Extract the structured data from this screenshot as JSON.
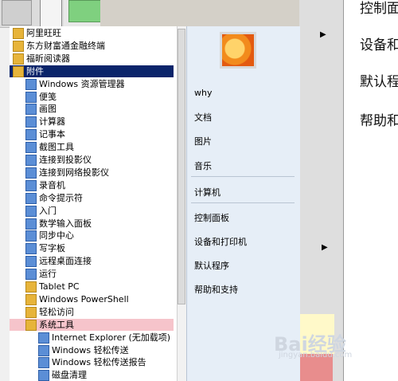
{
  "programs": {
    "items": [
      {
        "label": "阿里旺旺",
        "icon": "folder-icon",
        "type": "folder",
        "selected": false,
        "indent": 0
      },
      {
        "label": "东方财富通金融终端",
        "icon": "folder-icon",
        "type": "folder",
        "selected": false,
        "indent": 0
      },
      {
        "label": "福昕阅读器",
        "icon": "folder-icon",
        "type": "folder",
        "selected": false,
        "indent": 0
      },
      {
        "label": "附件",
        "icon": "folder-icon",
        "type": "folder",
        "selected": true,
        "indent": 0
      },
      {
        "label": "Windows 资源管理器",
        "icon": "explorer-icon",
        "type": "prog",
        "selected": false,
        "indent": 1
      },
      {
        "label": "便笺",
        "icon": "sticky-note-icon",
        "type": "prog",
        "selected": false,
        "indent": 1
      },
      {
        "label": "画图",
        "icon": "paint-icon",
        "type": "prog",
        "selected": false,
        "indent": 1
      },
      {
        "label": "计算器",
        "icon": "calculator-icon",
        "type": "prog",
        "selected": false,
        "indent": 1
      },
      {
        "label": "记事本",
        "icon": "notepad-icon",
        "type": "prog",
        "selected": false,
        "indent": 1
      },
      {
        "label": "截图工具",
        "icon": "snipping-tool-icon",
        "type": "prog",
        "selected": false,
        "indent": 1
      },
      {
        "label": "连接到投影仪",
        "icon": "projector-icon",
        "type": "prog",
        "selected": false,
        "indent": 1
      },
      {
        "label": "连接到网络投影仪",
        "icon": "network-projector-icon",
        "type": "prog",
        "selected": false,
        "indent": 1
      },
      {
        "label": "录音机",
        "icon": "sound-recorder-icon",
        "type": "prog",
        "selected": false,
        "indent": 1
      },
      {
        "label": "命令提示符",
        "icon": "command-prompt-icon",
        "type": "prog",
        "selected": false,
        "indent": 1
      },
      {
        "label": "入门",
        "icon": "getting-started-icon",
        "type": "prog",
        "selected": false,
        "indent": 1
      },
      {
        "label": "数学输入面板",
        "icon": "math-input-icon",
        "type": "prog",
        "selected": false,
        "indent": 1
      },
      {
        "label": "同步中心",
        "icon": "sync-center-icon",
        "type": "prog",
        "selected": false,
        "indent": 1
      },
      {
        "label": "写字板",
        "icon": "wordpad-icon",
        "type": "prog",
        "selected": false,
        "indent": 1
      },
      {
        "label": "远程桌面连接",
        "icon": "remote-desktop-icon",
        "type": "prog",
        "selected": false,
        "indent": 1
      },
      {
        "label": "运行",
        "icon": "run-icon",
        "type": "prog",
        "selected": false,
        "indent": 1
      },
      {
        "label": "Tablet PC",
        "icon": "folder-icon",
        "type": "folder",
        "selected": false,
        "indent": 1
      },
      {
        "label": "Windows PowerShell",
        "icon": "folder-icon",
        "type": "folder",
        "selected": false,
        "indent": 1
      },
      {
        "label": "轻松访问",
        "icon": "folder-icon",
        "type": "folder",
        "selected": false,
        "indent": 1
      },
      {
        "label": "系统工具",
        "icon": "folder-icon",
        "type": "folder",
        "selected": false,
        "highlight": true,
        "indent": 1
      },
      {
        "label": "Internet Explorer (无加载项)",
        "icon": "internet-explorer-icon",
        "type": "prog",
        "selected": false,
        "indent": 2
      },
      {
        "label": "Windows 轻松传送",
        "icon": "easy-transfer-icon",
        "type": "prog",
        "selected": false,
        "indent": 2
      },
      {
        "label": "Windows 轻松传送报告",
        "icon": "easy-transfer-reports-icon",
        "type": "prog",
        "selected": false,
        "indent": 2
      },
      {
        "label": "磁盘清理",
        "icon": "disk-cleanup-icon",
        "type": "prog",
        "selected": false,
        "indent": 2
      }
    ]
  },
  "right_column": {
    "user": "why",
    "items": [
      "文档",
      "图片",
      "音乐",
      "计算机",
      "控制面板",
      "设备和打印机",
      "默认程序",
      "帮助和支持"
    ]
  },
  "right_panel": {
    "items": [
      "控制面",
      "设备和",
      "默认程",
      "帮助和"
    ]
  },
  "watermark": {
    "text": "Bai经验",
    "sub": "jingyan.baidu.com"
  },
  "colors": {
    "selected_bg": "#0a246a",
    "highlight_bg": "#f6c4cb",
    "right_col_bg": "#e6eef7",
    "folder": "#e7b43a"
  }
}
